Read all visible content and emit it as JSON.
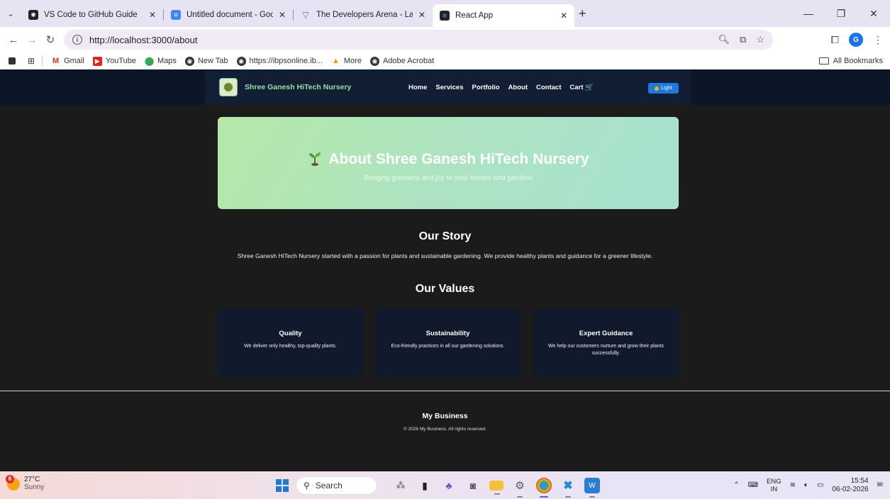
{
  "browser": {
    "tabs": [
      {
        "title": "VS Code to GitHub Guide",
        "active": false
      },
      {
        "title": "Untitled document - Google Do",
        "active": false
      },
      {
        "title": "The Developers Arena - Launch",
        "active": false
      },
      {
        "title": "React App",
        "active": true
      }
    ],
    "url": "http://localhost:3000/about",
    "bookmarks": [
      "Gmail",
      "YouTube",
      "Maps",
      "New Tab",
      "https://ibpsonline.ib...",
      "More",
      "Adobe Acrobat"
    ],
    "all_bookmarks": "All Bookmarks",
    "profile_initial": "G"
  },
  "site": {
    "brand": "Shree Ganesh HiTech Nursery",
    "nav": [
      "Home",
      "Services",
      "Portfolio",
      "About",
      "Contact",
      "Cart 🛒"
    ],
    "theme_button": "Light",
    "hero_title": "About Shree Ganesh HiTech Nursery",
    "hero_subtitle": "Bringing greenery and joy to your homes and gardens",
    "story_heading": "Our Story",
    "story_text": "Shree Ganesh HiTech Nursery started with a passion for plants and sustainable gardening. We provide healthy plants and guidance for a greener lifestyle.",
    "values_heading": "Our Values",
    "values": [
      {
        "title": "Quality",
        "text": "We deliver only healthy, top-quality plants."
      },
      {
        "title": "Sustainability",
        "text": "Eco-friendly practices in all our gardening solutions."
      },
      {
        "title": "Expert Guidance",
        "text": "We help our customers nurture and grow their plants successfully."
      }
    ],
    "footer_title": "My Business",
    "footer_text": "© 2026 My Business. All rights reserved."
  },
  "taskbar": {
    "weather_temp": "27°C",
    "weather_desc": "Sunny",
    "weather_badge": "6",
    "search_placeholder": "Search",
    "lang_top": "ENG",
    "lang_bottom": "IN",
    "time": "15:54",
    "date": "06-02-2026"
  },
  "colors": {
    "nav_bg": "#111e33",
    "brand_green": "#8fe3a5",
    "hero_gradient_start": "#b5e8a8",
    "hero_gradient_end": "#a7e2d0",
    "card_bg": "#101a2c",
    "page_bg": "#1b1b1b",
    "accent_blue": "#1f7ae0"
  }
}
